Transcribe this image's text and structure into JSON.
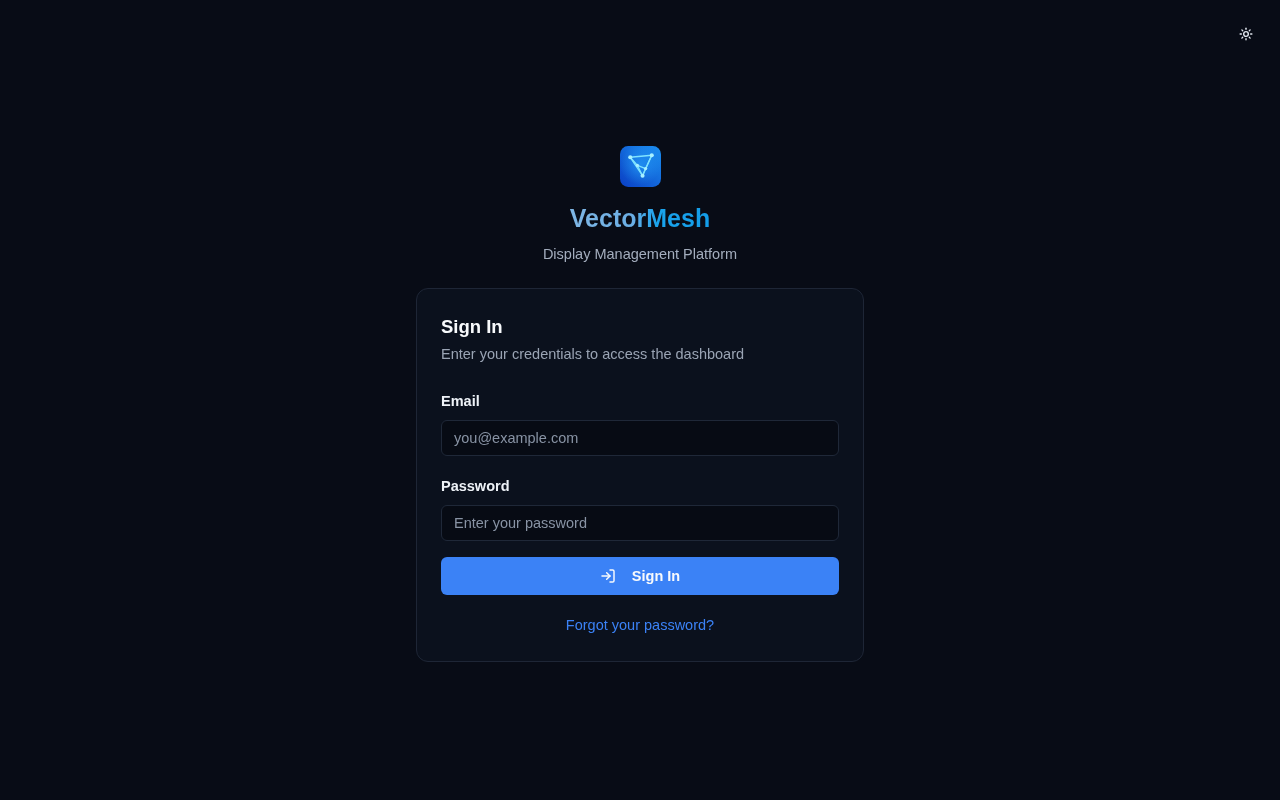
{
  "brand": {
    "name": "VectorMesh",
    "tagline": "Display Management Platform"
  },
  "card": {
    "title": "Sign In",
    "subtitle": "Enter your credentials to access the dashboard",
    "fields": [
      {
        "label": "Email",
        "placeholder": "you@example.com"
      },
      {
        "label": "Password",
        "placeholder": "Enter your password"
      }
    ],
    "submit": "Sign In",
    "forgot_link": "Forgot your password?"
  }
}
